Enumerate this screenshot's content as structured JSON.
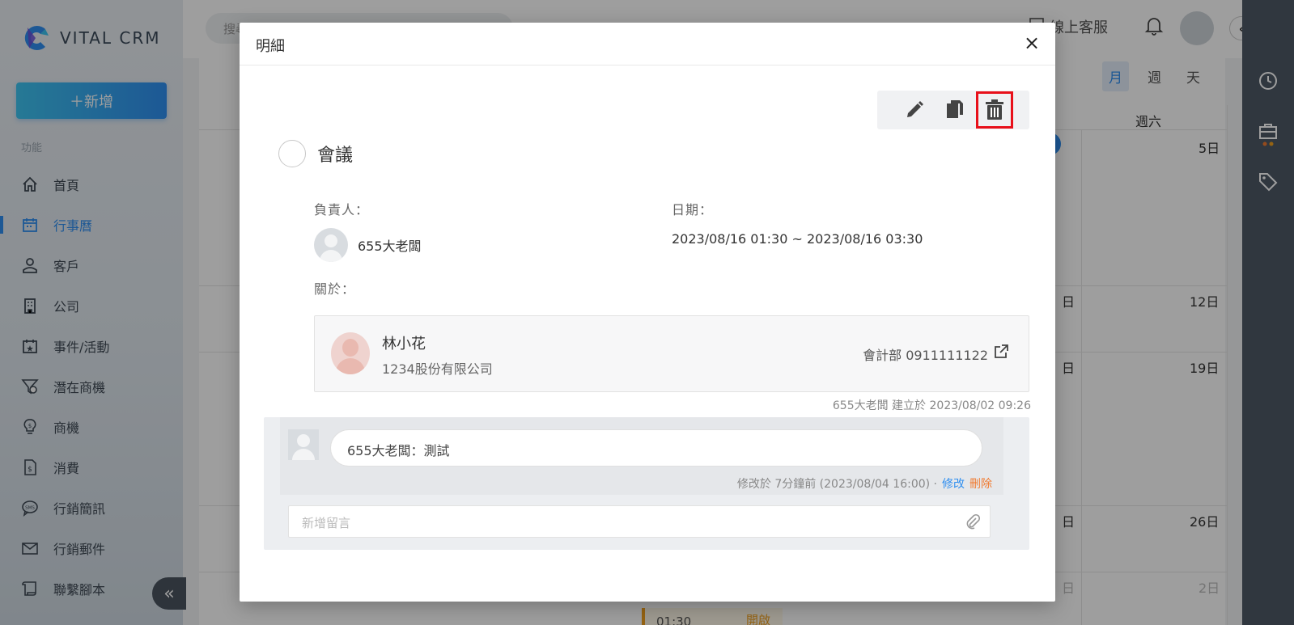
{
  "sidebar": {
    "logo_text": "VITAL CRM",
    "add_button_label": "＋新增",
    "section_label": "功能",
    "items": [
      {
        "label": "首頁",
        "icon": "home-icon"
      },
      {
        "label": "行事曆",
        "icon": "calendar-icon",
        "active": true
      },
      {
        "label": "客戶",
        "icon": "customer-icon"
      },
      {
        "label": "公司",
        "icon": "building-icon"
      },
      {
        "label": "事件/活動",
        "icon": "event-icon"
      },
      {
        "label": "潛在商機",
        "icon": "lead-icon"
      },
      {
        "label": "商機",
        "icon": "opportunity-icon"
      },
      {
        "label": "消費",
        "icon": "receipt-icon"
      },
      {
        "label": "行銷簡訊",
        "icon": "sms-icon"
      },
      {
        "label": "行銷郵件",
        "icon": "mail-icon"
      },
      {
        "label": "聯繫腳本",
        "icon": "script-icon"
      }
    ],
    "collapse_label": "«"
  },
  "topbar": {
    "search_placeholder": "搜尋名字",
    "support_label": "線上客服"
  },
  "calendar": {
    "view_tabs": [
      "月",
      "週",
      "天"
    ],
    "active_view": "月",
    "saturday_header": "週六",
    "dates_right": [
      "5日",
      "12日",
      "19日",
      "26日",
      "2日"
    ],
    "dates_left_partial": [
      "日",
      "日",
      "日",
      "日",
      "日"
    ],
    "event_time": "01:30",
    "event_status": "開啟"
  },
  "modal": {
    "title": "明細",
    "close_label": "×",
    "actions": [
      "edit-icon",
      "copy-icon",
      "trash-icon"
    ],
    "event_title": "會議",
    "owner_label": "負責人：",
    "owner_name": "655大老闆",
    "date_label": "日期：",
    "date_value": "2023/08/16 01:30 ~ 2023/08/16 03:30",
    "about_label": "關於：",
    "contact": {
      "name": "林小花",
      "company": "1234股份有限公司",
      "dept_phone": "會計部 0911111122"
    },
    "created_meta": "655大老闆 建立於 2023/08/02 09:26",
    "comment": {
      "text": "655大老闆：測試",
      "meta": "修改於 7分鐘前 (2023/08/04 16:00) ·",
      "edit_label": "修改",
      "delete_label": "刪除"
    },
    "new_comment_placeholder": "新增留言"
  },
  "colors": {
    "accent": "#2f8ff0",
    "highlight_box": "#e8101a",
    "rail": "#4e5966"
  }
}
